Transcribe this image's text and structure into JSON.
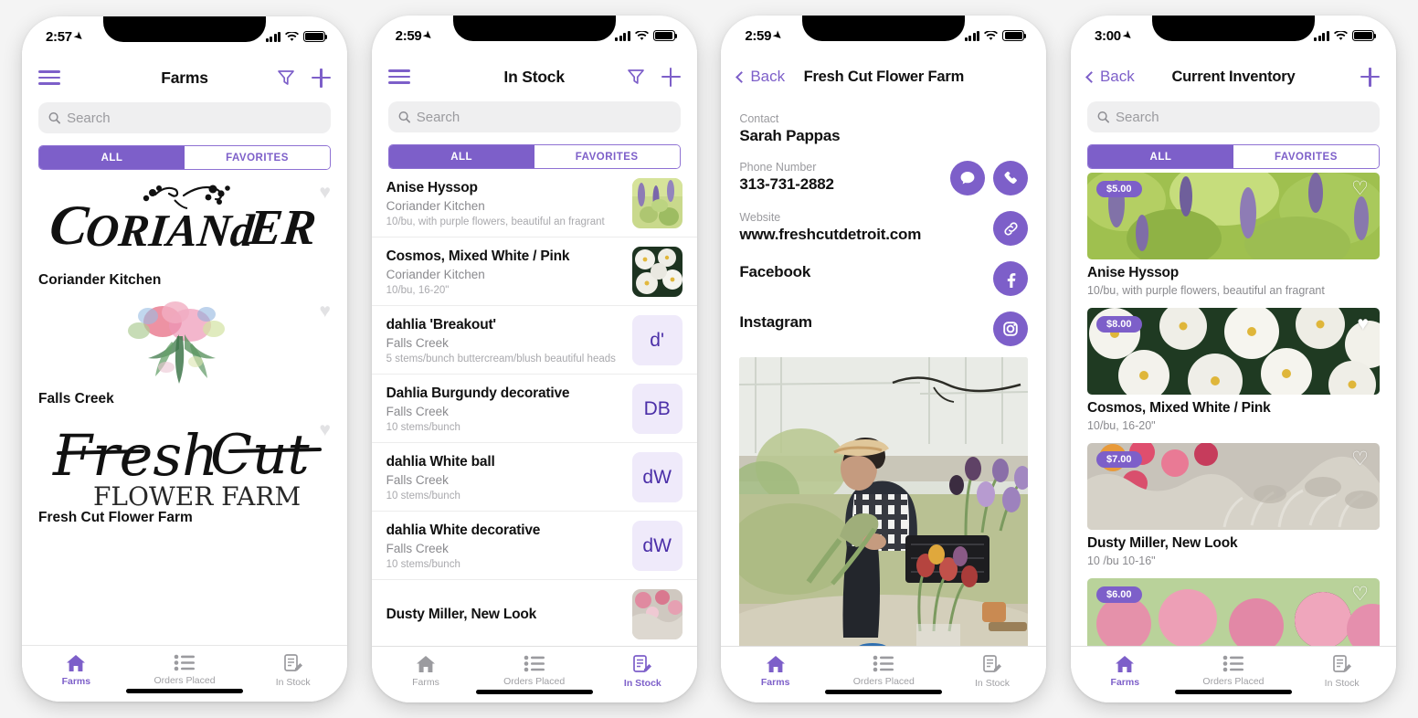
{
  "accent": "#7d5fc9",
  "screens": [
    {
      "id": "farms",
      "status": {
        "time": "2:57"
      },
      "nav": {
        "title": "Farms",
        "menu_label": "menu",
        "filter_label": "filter",
        "add_label": "add"
      },
      "search": {
        "placeholder": "Search",
        "value": ""
      },
      "segments": [
        {
          "label": "ALL",
          "active": true
        },
        {
          "label": "FAVORITES",
          "active": false
        }
      ],
      "farms": [
        {
          "name": "Coriander Kitchen",
          "logo": "coriander-script-logo",
          "favorite": false
        },
        {
          "name": "Falls Creek",
          "logo": "watercolor-bouquet-logo",
          "favorite": false
        },
        {
          "name": "Fresh Cut Flower Farm",
          "logo": "fresh-cut-script-logo",
          "favorite": false
        }
      ],
      "tabs": [
        {
          "label": "Farms",
          "icon": "home-icon",
          "active": true
        },
        {
          "label": "Orders Placed",
          "icon": "list-icon",
          "active": false
        },
        {
          "label": "In Stock",
          "icon": "note-pencil-icon",
          "active": false
        }
      ]
    },
    {
      "id": "instock",
      "status": {
        "time": "2:59"
      },
      "nav": {
        "title": "In Stock",
        "menu_label": "menu",
        "filter_label": "filter",
        "add_label": "add"
      },
      "search": {
        "placeholder": "Search",
        "value": ""
      },
      "segments": [
        {
          "label": "ALL",
          "active": true
        },
        {
          "label": "FAVORITES",
          "active": false
        }
      ],
      "items": [
        {
          "title": "Anise Hyssop",
          "farm": "Coriander Kitchen",
          "desc": "10/bu, with purple flowers, beautiful an fragrant",
          "thumb": "anise-hyssop-photo"
        },
        {
          "title": "Cosmos, Mixed White / Pink",
          "farm": "Coriander Kitchen",
          "desc": "10/bu, 16-20\"",
          "thumb": "cosmos-white-photo"
        },
        {
          "title": "dahlia 'Breakout'",
          "farm": "Falls Creek",
          "desc": "5 stems/bunch buttercream/blush beautiful heads",
          "initials": "d'"
        },
        {
          "title": "Dahlia Burgundy decorative",
          "farm": "Falls Creek",
          "desc": "10 stems/bunch",
          "initials": "DB"
        },
        {
          "title": "dahlia White ball",
          "farm": "Falls Creek",
          "desc": "10 stems/bunch",
          "initials": "dW"
        },
        {
          "title": "dahlia White decorative",
          "farm": "Falls Creek",
          "desc": "10 stems/bunch",
          "initials": "dW"
        },
        {
          "title": "Dusty Miller, New Look",
          "farm": "",
          "desc": "",
          "thumb": "dusty-miller-photo"
        }
      ],
      "tabs": [
        {
          "label": "Farms",
          "icon": "home-icon",
          "active": false
        },
        {
          "label": "Orders Placed",
          "icon": "list-icon",
          "active": false
        },
        {
          "label": "In Stock",
          "icon": "note-pencil-icon",
          "active": true
        }
      ]
    },
    {
      "id": "farm-detail",
      "status": {
        "time": "2:59"
      },
      "nav": {
        "back_label": "Back",
        "title": "Fresh Cut Flower Farm",
        "add_label": ""
      },
      "fields": [
        {
          "label": "Contact",
          "value": "Sarah Pappas",
          "actions": []
        },
        {
          "label": "Phone Number",
          "value": "313-731-2882",
          "actions": [
            "message-icon",
            "phone-icon"
          ]
        },
        {
          "label": "Website",
          "value": "www.freshcutdetroit.com",
          "actions": [
            "link-icon"
          ]
        },
        {
          "label": "",
          "value": "Facebook",
          "actions": [
            "facebook-icon"
          ]
        },
        {
          "label": "",
          "value": "Instagram",
          "actions": [
            "instagram-icon"
          ]
        }
      ],
      "photo": "farmer-arranging-flowers-photo",
      "tabs": [
        {
          "label": "Farms",
          "icon": "home-icon",
          "active": true
        },
        {
          "label": "Orders Placed",
          "icon": "list-icon",
          "active": false
        },
        {
          "label": "In Stock",
          "icon": "note-pencil-icon",
          "active": false
        }
      ]
    },
    {
      "id": "inventory",
      "status": {
        "time": "3:00"
      },
      "nav": {
        "back_label": "Back",
        "title": "Current Inventory",
        "add_label": "add"
      },
      "search": {
        "placeholder": "Search",
        "value": ""
      },
      "segments": [
        {
          "label": "ALL",
          "active": true
        },
        {
          "label": "FAVORITES",
          "active": false
        }
      ],
      "cards": [
        {
          "price": "$5.00",
          "title": "Anise Hyssop",
          "sub": "10/bu, with purple flowers, beautiful an fragrant",
          "image": "anise-hyssop-photo",
          "favorite": false
        },
        {
          "price": "$8.00",
          "title": "Cosmos, Mixed White / Pink",
          "sub": "10/bu, 16-20\"",
          "image": "cosmos-white-photo",
          "favorite": true
        },
        {
          "price": "$7.00",
          "title": "Dusty Miller, New Look",
          "sub": "10 /bu 10-16\"",
          "image": "dusty-miller-photo",
          "favorite": false
        },
        {
          "price": "$6.00",
          "title": "",
          "sub": "",
          "image": "pink-blooms-photo",
          "favorite": false
        }
      ],
      "tabs": [
        {
          "label": "Farms",
          "icon": "home-icon",
          "active": true
        },
        {
          "label": "Orders Placed",
          "icon": "list-icon",
          "active": false
        },
        {
          "label": "In Stock",
          "icon": "note-pencil-icon",
          "active": false
        }
      ]
    }
  ]
}
